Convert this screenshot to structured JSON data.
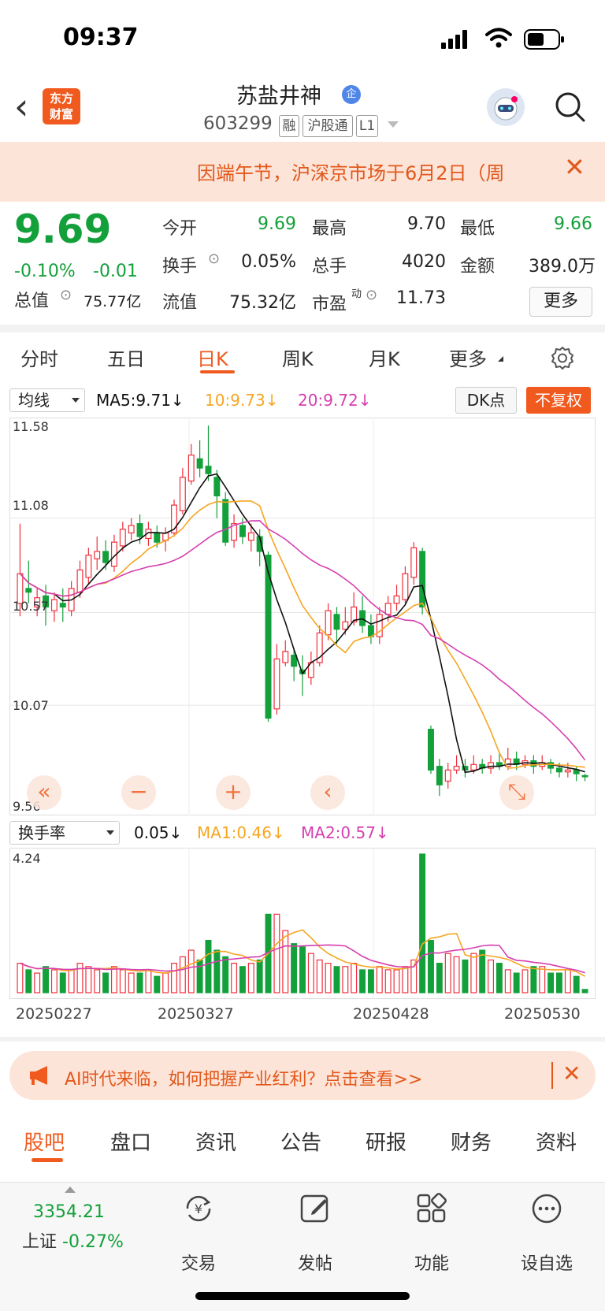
{
  "status_bar": {
    "time": "09:37"
  },
  "header": {
    "back": "‹",
    "logo_line1": "东方",
    "logo_line2": "财富",
    "stock_name": "苏盐井神",
    "badge": "企",
    "stock_code": "603299",
    "tags": [
      "融",
      "沪股通",
      "L1"
    ]
  },
  "notice": {
    "text": "因端午节，沪深京市场于6月2日（周",
    "close": "✕"
  },
  "quote": {
    "price": "9.69",
    "change_pct": "-0.10%",
    "change": "-0.01",
    "total_value_label": "总值",
    "total_value": "75.77亿",
    "rows": [
      [
        {
          "label": "今开",
          "value": "9.69",
          "green": true
        },
        {
          "label": "最高",
          "value": "9.70",
          "green": false
        },
        {
          "label": "最低",
          "value": "9.66",
          "green": true
        }
      ],
      [
        {
          "label": "换手",
          "value": "0.05%",
          "green": false
        },
        {
          "label": "总手",
          "value": "4020",
          "green": false
        },
        {
          "label": "金额",
          "value": "389.0万",
          "green": false
        }
      ],
      [
        {
          "label": "流值",
          "value": "75.32亿",
          "green": false
        },
        {
          "label": "市盈",
          "value": "11.73",
          "green": false
        }
      ]
    ],
    "pe_sup": "动",
    "more": "更多"
  },
  "period_tabs": [
    "分时",
    "五日",
    "日K",
    "周K",
    "月K",
    "更多"
  ],
  "active_tab": "日K",
  "kline": {
    "indicator_select": "均线",
    "ma5": "MA5:9.71↓",
    "ma10": "10:9.73↓",
    "ma20": "20:9.72↓",
    "dk_button": "DK点",
    "fq_button": "不复权",
    "y_labels": [
      "11.58",
      "11.08",
      "10.57",
      "10.07",
      "9.56"
    ],
    "controls": [
      "«",
      "−",
      "+",
      "‹",
      "⤡"
    ],
    "colors": {
      "up": "#f0303c",
      "down": "#13a03a",
      "ma5": "#111111",
      "ma10": "#f5a623",
      "ma20": "#d63fb0"
    }
  },
  "turnover": {
    "indicator_select": "换手率",
    "value": "0.05↓",
    "ma1": "MA1:0.46↓",
    "ma2": "MA2:0.57↓",
    "y_top": "4.24"
  },
  "dates": [
    "20250227",
    "20250327",
    "20250428",
    "20250530"
  ],
  "ad": {
    "text": "AI时代来临，如何把握产业红利？点击查看>>",
    "close": "✕"
  },
  "bottom_tabs": [
    "股吧",
    "盘口",
    "资讯",
    "公告",
    "研报",
    "财务",
    "资料"
  ],
  "bottom_nav": {
    "index_value": "3354.21",
    "index_label": "上证",
    "index_change": "-0.27%",
    "items": [
      "交易",
      "发帖",
      "功能",
      "设自选"
    ]
  },
  "chart_data": {
    "type": "candlestick",
    "ylim": [
      9.56,
      11.58
    ],
    "turnover_ylim": [
      0,
      4.24
    ],
    "x_ticks": [
      "20250227",
      "20250327",
      "20250428",
      "20250530"
    ],
    "candles": [
      {
        "o": 10.62,
        "c": 10.78,
        "h": 11.05,
        "l": 10.55,
        "up": true
      },
      {
        "o": 10.7,
        "c": 10.68,
        "h": 10.85,
        "l": 10.62,
        "up": false
      },
      {
        "o": 10.6,
        "c": 10.65,
        "h": 10.7,
        "l": 10.55,
        "up": true
      },
      {
        "o": 10.66,
        "c": 10.6,
        "h": 10.72,
        "l": 10.5,
        "up": false
      },
      {
        "o": 10.58,
        "c": 10.64,
        "h": 10.68,
        "l": 10.52,
        "up": true
      },
      {
        "o": 10.62,
        "c": 10.6,
        "h": 10.7,
        "l": 10.52,
        "up": false
      },
      {
        "o": 10.58,
        "c": 10.7,
        "h": 10.74,
        "l": 10.55,
        "up": true
      },
      {
        "o": 10.68,
        "c": 10.8,
        "h": 10.85,
        "l": 10.65,
        "up": true
      },
      {
        "o": 10.76,
        "c": 10.88,
        "h": 10.92,
        "l": 10.72,
        "up": true
      },
      {
        "o": 10.86,
        "c": 10.9,
        "h": 10.98,
        "l": 10.8,
        "up": true
      },
      {
        "o": 10.9,
        "c": 10.84,
        "h": 10.96,
        "l": 10.8,
        "up": false
      },
      {
        "o": 10.82,
        "c": 10.95,
        "h": 10.99,
        "l": 10.79,
        "up": true
      },
      {
        "o": 10.93,
        "c": 11.02,
        "h": 11.06,
        "l": 10.9,
        "up": true
      },
      {
        "o": 11.0,
        "c": 11.04,
        "h": 11.08,
        "l": 10.96,
        "up": true
      },
      {
        "o": 11.05,
        "c": 10.98,
        "h": 11.1,
        "l": 10.94,
        "up": false
      },
      {
        "o": 10.97,
        "c": 11.02,
        "h": 11.06,
        "l": 10.93,
        "up": true
      },
      {
        "o": 11.0,
        "c": 10.95,
        "h": 11.04,
        "l": 10.92,
        "up": false
      },
      {
        "o": 10.96,
        "c": 11.0,
        "h": 11.03,
        "l": 10.9,
        "up": true
      },
      {
        "o": 11.0,
        "c": 11.15,
        "h": 11.18,
        "l": 10.98,
        "up": true
      },
      {
        "o": 11.12,
        "c": 11.3,
        "h": 11.35,
        "l": 11.1,
        "up": true
      },
      {
        "o": 11.28,
        "c": 11.42,
        "h": 11.48,
        "l": 11.26,
        "up": true
      },
      {
        "o": 11.4,
        "c": 11.35,
        "h": 11.5,
        "l": 11.3,
        "up": false
      },
      {
        "o": 11.36,
        "c": 11.32,
        "h": 11.58,
        "l": 11.28,
        "up": false
      },
      {
        "o": 11.3,
        "c": 11.2,
        "h": 11.34,
        "l": 11.08,
        "up": false
      },
      {
        "o": 11.18,
        "c": 10.95,
        "h": 11.22,
        "l": 10.93,
        "up": false
      },
      {
        "o": 10.96,
        "c": 11.05,
        "h": 11.1,
        "l": 10.92,
        "up": true
      },
      {
        "o": 11.04,
        "c": 10.98,
        "h": 11.08,
        "l": 10.94,
        "up": false
      },
      {
        "o": 10.96,
        "c": 11.0,
        "h": 11.05,
        "l": 10.9,
        "up": true
      },
      {
        "o": 10.98,
        "c": 10.9,
        "h": 11.02,
        "l": 10.82,
        "up": false
      },
      {
        "o": 10.88,
        "c": 10.0,
        "h": 10.9,
        "l": 9.98,
        "up": false
      },
      {
        "o": 10.05,
        "c": 10.32,
        "h": 10.4,
        "l": 10.02,
        "up": true
      },
      {
        "o": 10.3,
        "c": 10.36,
        "h": 10.42,
        "l": 10.28,
        "up": true
      },
      {
        "o": 10.34,
        "c": 10.28,
        "h": 10.38,
        "l": 10.2,
        "up": false
      },
      {
        "o": 10.26,
        "c": 10.24,
        "h": 10.34,
        "l": 10.12,
        "up": false
      },
      {
        "o": 10.22,
        "c": 10.3,
        "h": 10.36,
        "l": 10.18,
        "up": true
      },
      {
        "o": 10.3,
        "c": 10.46,
        "h": 10.5,
        "l": 10.28,
        "up": true
      },
      {
        "o": 10.45,
        "c": 10.58,
        "h": 10.62,
        "l": 10.42,
        "up": true
      },
      {
        "o": 10.56,
        "c": 10.48,
        "h": 10.6,
        "l": 10.4,
        "up": false
      },
      {
        "o": 10.48,
        "c": 10.52,
        "h": 10.6,
        "l": 10.45,
        "up": true
      },
      {
        "o": 10.52,
        "c": 10.6,
        "h": 10.68,
        "l": 10.5,
        "up": true
      },
      {
        "o": 10.58,
        "c": 10.5,
        "h": 10.66,
        "l": 10.46,
        "up": false
      },
      {
        "o": 10.5,
        "c": 10.44,
        "h": 10.56,
        "l": 10.4,
        "up": false
      },
      {
        "o": 10.44,
        "c": 10.56,
        "h": 10.6,
        "l": 10.4,
        "up": true
      },
      {
        "o": 10.56,
        "c": 10.62,
        "h": 10.66,
        "l": 10.52,
        "up": true
      },
      {
        "o": 10.62,
        "c": 10.66,
        "h": 10.72,
        "l": 10.58,
        "up": true
      },
      {
        "o": 10.64,
        "c": 10.78,
        "h": 10.82,
        "l": 10.62,
        "up": true
      },
      {
        "o": 10.76,
        "c": 10.92,
        "h": 10.95,
        "l": 10.72,
        "up": true
      },
      {
        "o": 10.9,
        "c": 10.6,
        "h": 10.92,
        "l": 10.56,
        "up": false
      },
      {
        "o": 9.94,
        "c": 9.72,
        "h": 9.96,
        "l": 9.7,
        "up": false
      },
      {
        "o": 9.74,
        "c": 9.64,
        "h": 9.78,
        "l": 9.58,
        "up": false
      },
      {
        "o": 9.66,
        "c": 9.72,
        "h": 9.76,
        "l": 9.62,
        "up": true
      },
      {
        "o": 9.72,
        "c": 9.74,
        "h": 9.8,
        "l": 9.7,
        "up": true
      },
      {
        "o": 9.74,
        "c": 9.72,
        "h": 9.78,
        "l": 9.68,
        "up": false
      },
      {
        "o": 9.72,
        "c": 9.75,
        "h": 9.8,
        "l": 9.7,
        "up": true
      },
      {
        "o": 9.75,
        "c": 9.73,
        "h": 9.78,
        "l": 9.7,
        "up": false
      },
      {
        "o": 9.73,
        "c": 9.76,
        "h": 9.8,
        "l": 9.7,
        "up": true
      },
      {
        "o": 9.76,
        "c": 9.74,
        "h": 9.82,
        "l": 9.72,
        "up": false
      },
      {
        "o": 9.74,
        "c": 9.78,
        "h": 9.84,
        "l": 9.72,
        "up": true
      },
      {
        "o": 9.78,
        "c": 9.75,
        "h": 9.82,
        "l": 9.72,
        "up": false
      },
      {
        "o": 9.75,
        "c": 9.77,
        "h": 9.8,
        "l": 9.73,
        "up": true
      },
      {
        "o": 9.77,
        "c": 9.74,
        "h": 9.8,
        "l": 9.7,
        "up": false
      },
      {
        "o": 9.74,
        "c": 9.76,
        "h": 9.8,
        "l": 9.72,
        "up": true
      },
      {
        "o": 9.76,
        "c": 9.73,
        "h": 9.78,
        "l": 9.7,
        "up": false
      },
      {
        "o": 9.73,
        "c": 9.71,
        "h": 9.76,
        "l": 9.68,
        "up": false
      },
      {
        "o": 9.71,
        "c": 9.72,
        "h": 9.76,
        "l": 9.68,
        "up": true
      },
      {
        "o": 9.72,
        "c": 9.7,
        "h": 9.74,
        "l": 9.66,
        "up": false
      },
      {
        "o": 9.69,
        "c": 9.69,
        "h": 9.7,
        "l": 9.66,
        "up": false
      }
    ],
    "turnover_values": [
      0.9,
      0.7,
      0.6,
      0.8,
      0.7,
      0.6,
      0.7,
      0.9,
      0.8,
      0.7,
      0.6,
      0.8,
      0.7,
      0.6,
      0.6,
      0.7,
      0.5,
      0.6,
      0.9,
      1.1,
      1.3,
      1.0,
      1.6,
      1.3,
      1.1,
      0.9,
      0.8,
      0.9,
      1.0,
      2.4,
      2.4,
      1.9,
      1.5,
      1.4,
      1.2,
      1.0,
      0.9,
      0.8,
      0.8,
      0.9,
      0.7,
      0.7,
      0.8,
      0.7,
      0.7,
      0.8,
      1.0,
      4.24,
      1.6,
      0.9,
      1.2,
      1.1,
      1.0,
      1.2,
      1.3,
      1.0,
      0.9,
      0.7,
      0.6,
      0.7,
      0.8,
      0.8,
      0.6,
      0.6,
      0.7,
      0.5,
      0.1
    ]
  }
}
